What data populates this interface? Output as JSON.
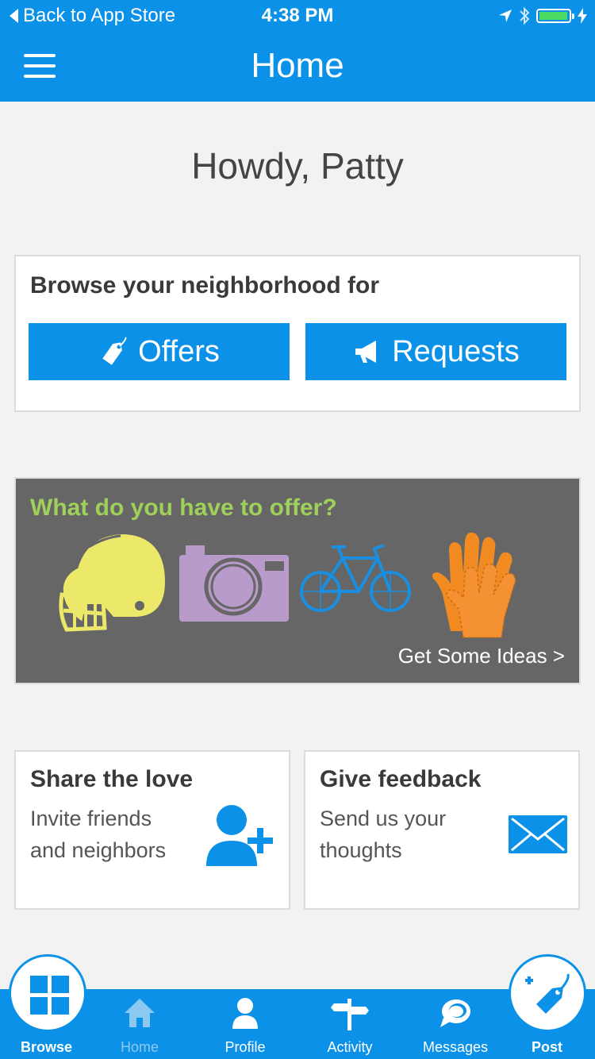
{
  "status_bar": {
    "back_label": "Back to App Store",
    "time": "4:38 PM"
  },
  "nav": {
    "title": "Home",
    "menu_icon": "hamburger-icon"
  },
  "greeting": "Howdy, Patty",
  "browse": {
    "heading": "Browse your neighborhood for",
    "offers_label": "Offers",
    "requests_label": "Requests"
  },
  "offer_banner": {
    "question": "What do you have to offer?",
    "link_label": "Get Some Ideas >",
    "images": [
      "football-helmet",
      "camera",
      "bicycle",
      "gloves"
    ]
  },
  "share_card": {
    "title": "Share the love",
    "description": "Invite friends and neighbors"
  },
  "feedback_card": {
    "title": "Give feedback",
    "description": "Send us your thoughts"
  },
  "tabs": {
    "browse": "Browse",
    "home": "Home",
    "profile": "Profile",
    "activity": "Activity",
    "messages": "Messages",
    "post": "Post"
  },
  "colors": {
    "primary": "#0b92e8",
    "banner_bg": "#666666",
    "question": "#9ed05a",
    "helmet": "#ece86a",
    "camera": "#b89acb",
    "bicycle": "#1a8fe0",
    "gloves": "#f28a22"
  }
}
